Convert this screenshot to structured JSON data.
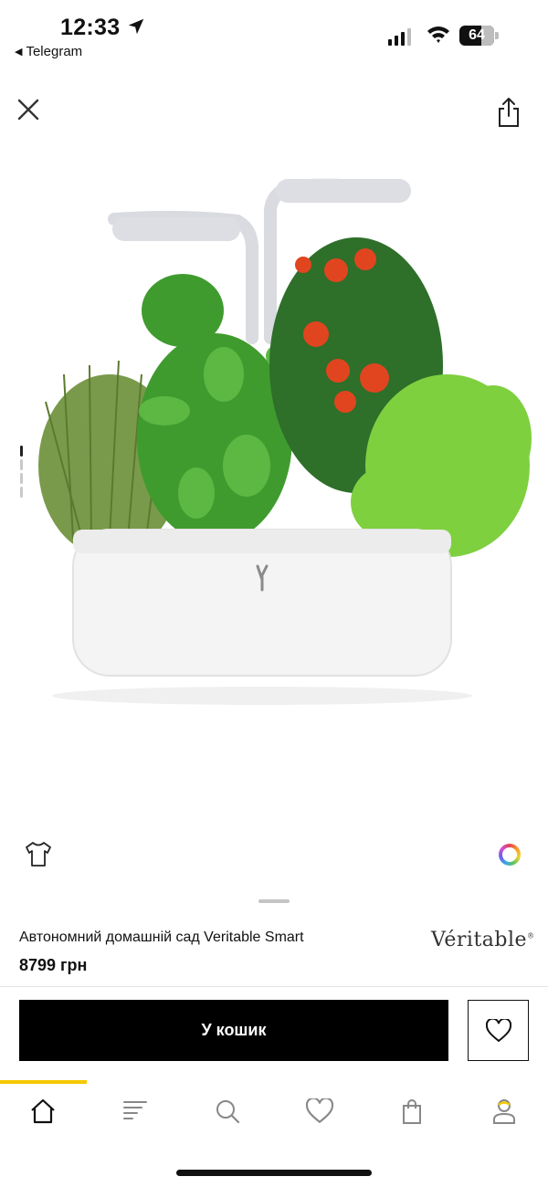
{
  "status_bar": {
    "time": "12:33",
    "back_app": "Telegram",
    "battery": "64",
    "battery_level_percent": 64
  },
  "page_indicator": {
    "total": 4,
    "active_index": 0
  },
  "product": {
    "title": "Автономний домашній сад Veritable Smart",
    "price": "8799 грн",
    "brand": "Véritable"
  },
  "actions": {
    "cart_label": "У кошик"
  },
  "nav": {
    "items": [
      "home-icon",
      "catalog-icon",
      "search-icon",
      "favorites-icon",
      "bag-icon",
      "profile-icon"
    ],
    "active_index": 0
  },
  "colors": {
    "accent_yellow": "#f5c800",
    "primary_black": "#000000"
  }
}
